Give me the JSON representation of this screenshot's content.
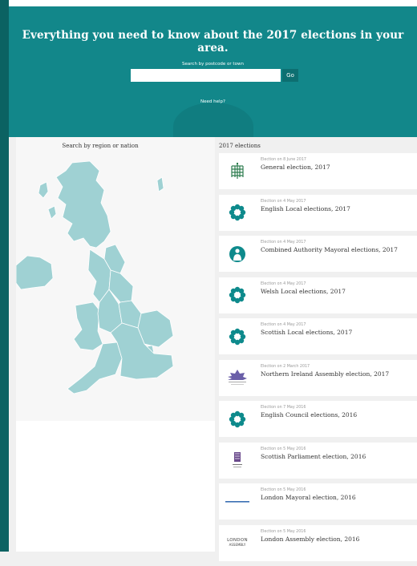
{
  "hero": {
    "title": "Everything you need to know about the 2017 elections in your area.",
    "search_label": "Search by postcode or town",
    "search_value": "",
    "go_label": "Go",
    "help_label": "Need help?"
  },
  "map": {
    "title": "Search by region or nation"
  },
  "list": {
    "title": "2017 elections",
    "items": [
      {
        "date": "Election on 8 June 2017",
        "name": "General election, 2017",
        "icon": "portcullis-icon"
      },
      {
        "date": "Election on 4 May 2017",
        "name": "English Local elections, 2017",
        "icon": "council-flower-icon"
      },
      {
        "date": "Election on 4 May 2017",
        "name": "Combined Authority Mayoral elections, 2017",
        "icon": "mayor-figure-icon"
      },
      {
        "date": "Election on 4 May 2017",
        "name": "Welsh Local elections, 2017",
        "icon": "council-flower-icon"
      },
      {
        "date": "Election on 4 May 2017",
        "name": "Scottish Local elections, 2017",
        "icon": "council-flower-icon"
      },
      {
        "date": "Election on 2 March 2017",
        "name": "Northern Ireland Assembly election, 2017",
        "icon": "ni-assembly-logo"
      },
      {
        "date": "Election on 7 May 2016",
        "name": "English Council elections, 2016",
        "icon": "council-flower-icon"
      },
      {
        "date": "Election on 5 May 2016",
        "name": "Scottish Parliament election, 2016",
        "icon": "scottish-parliament-logo"
      },
      {
        "date": "Election on 5 May 2016",
        "name": "London Mayoral election, 2016",
        "icon": "mayor-of-london-logo"
      },
      {
        "date": "Election on 5 May 2016",
        "name": "London Assembly election, 2016",
        "icon": "london-assembly-logo"
      }
    ],
    "logo_texts": {
      "london_assembly_1": "LONDON",
      "london_assembly_2": "ASSEMBLY"
    }
  },
  "colors": {
    "hero_bg": "#12878a",
    "strip": "#0b6262",
    "map_fill": "#9fd1d3",
    "icon_teal": "#0e8a8c"
  }
}
